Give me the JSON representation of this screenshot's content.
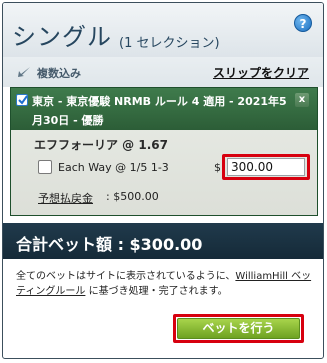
{
  "header": {
    "title": "シングル",
    "count": "(1 セレクション)",
    "help_glyph": "?"
  },
  "controls": {
    "multi_label": "複数込み",
    "clear_link": "スリップをクリア"
  },
  "selection": {
    "checked": true,
    "event": "東京 - 東京優駿 NRMB ルール 4 適用 - 2021年5月30日 - 優勝",
    "close_glyph": "x",
    "pick": "エフフォーリア @ 1.67",
    "each_way_label": "Each Way @ 1/5 1-3",
    "each_way_checked": false,
    "currency": "$",
    "stake": "300.00",
    "returns_label": "予想払戻金",
    "returns_value": ": $500.00"
  },
  "total": {
    "text": "合計ベット額 : $300.00"
  },
  "terms": {
    "before": "全てのベットはサイトに表示されているように、",
    "link": "WilliamHill ベッティングルール",
    "after": " に基づき処理・完了されます。"
  },
  "place_bet": {
    "label": "ベットを行う"
  },
  "colors": {
    "title": "#26465f",
    "selection_header": "#2c5d37",
    "total_bar": "#152a38",
    "place_button": "#6ea222",
    "highlight": "#d7000f"
  }
}
